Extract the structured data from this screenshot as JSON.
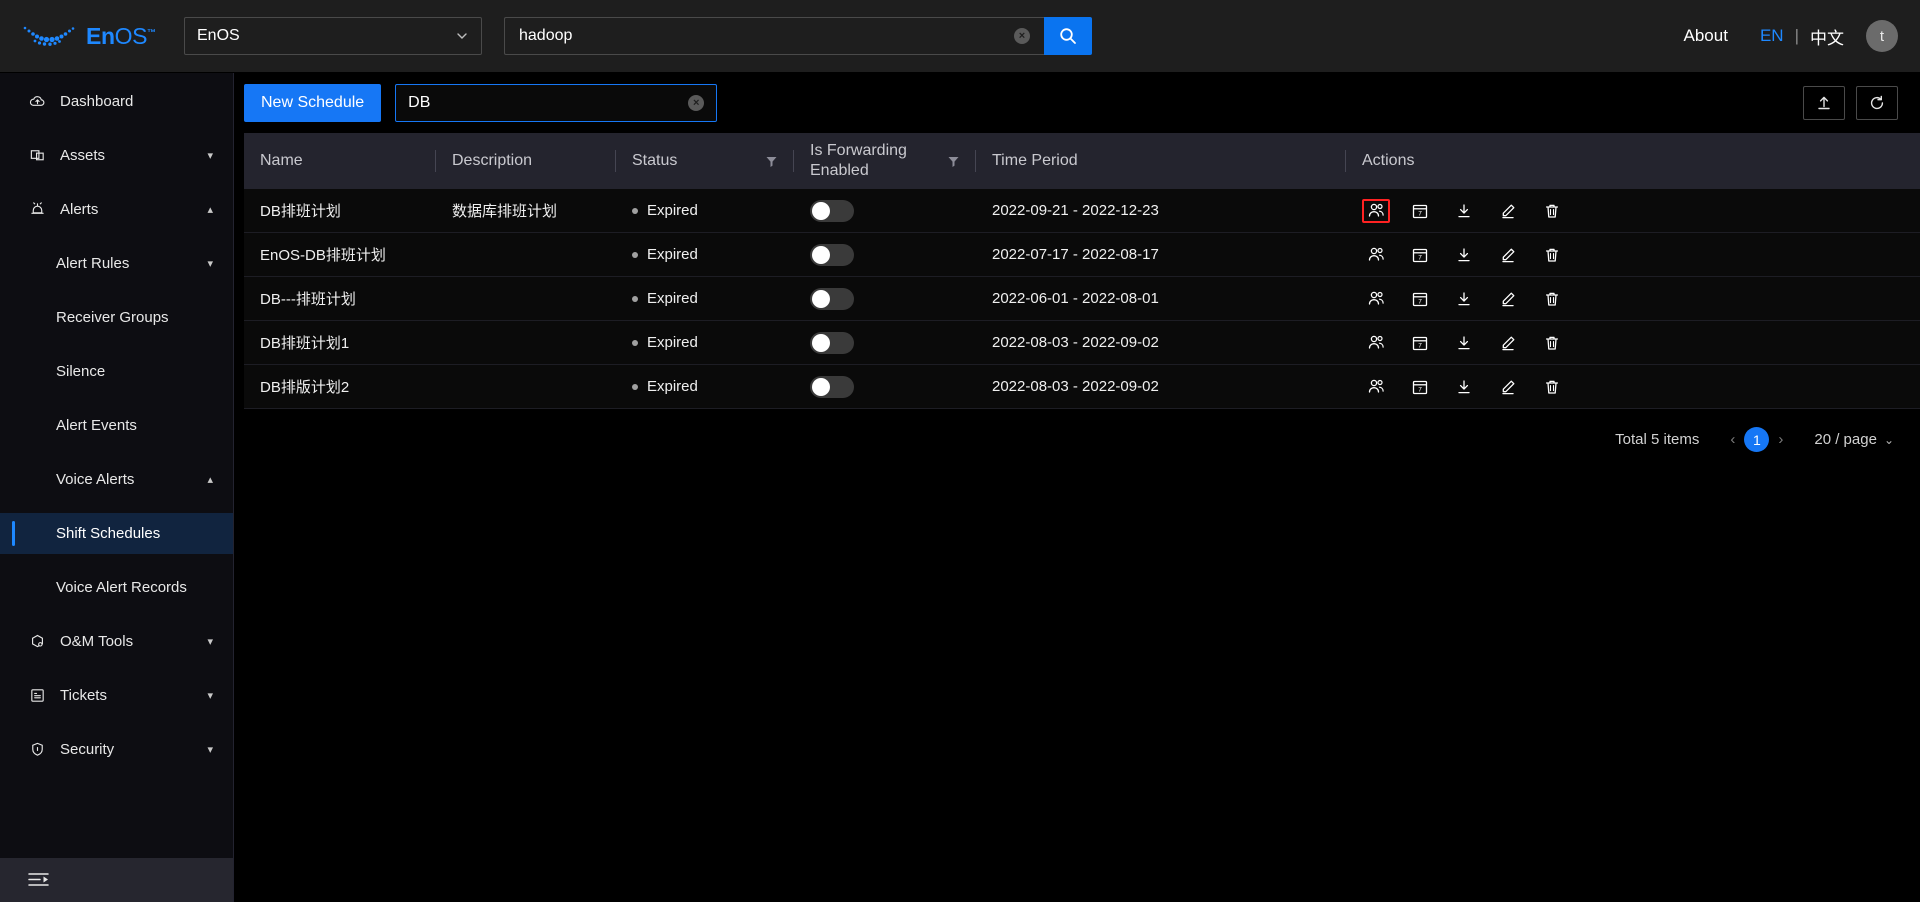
{
  "topbar": {
    "brand": {
      "bold": "En",
      "light": "OS",
      "tm": "™"
    },
    "app_selector": {
      "value": "EnOS",
      "caret": "chevron-down-icon"
    },
    "search": {
      "value": "hadoop",
      "placeholder": "",
      "clear": "×",
      "button_icon": "search-icon"
    },
    "about_label": "About",
    "lang_en": "EN",
    "lang_divider": "|",
    "lang_cn": "中文",
    "avatar_initial": "t"
  },
  "sidebar": {
    "items": [
      {
        "label": "Dashboard",
        "icon": "dashboard-cloud-icon",
        "level": 0,
        "caret": "",
        "active": false
      },
      {
        "label": "Assets",
        "icon": "assets-icon",
        "level": 0,
        "caret": "▾",
        "active": false
      },
      {
        "label": "Alerts",
        "icon": "alerts-bell-icon",
        "level": 0,
        "caret": "▴",
        "active": false
      },
      {
        "label": "Alert Rules",
        "icon": "",
        "level": 1,
        "caret": "▾",
        "active": false
      },
      {
        "label": "Receiver Groups",
        "icon": "",
        "level": 1,
        "caret": "",
        "active": false
      },
      {
        "label": "Silence",
        "icon": "",
        "level": 1,
        "caret": "",
        "active": false
      },
      {
        "label": "Alert Events",
        "icon": "",
        "level": 1,
        "caret": "",
        "active": false
      },
      {
        "label": "Voice Alerts",
        "icon": "",
        "level": 1,
        "caret": "▴",
        "active": false
      },
      {
        "label": "Shift Schedules",
        "icon": "",
        "level": 2,
        "caret": "",
        "active": true
      },
      {
        "label": "Voice Alert Records",
        "icon": "",
        "level": 2,
        "caret": "",
        "active": false
      },
      {
        "label": "O&M Tools",
        "icon": "om-tools-icon",
        "level": 0,
        "caret": "▾",
        "active": false
      },
      {
        "label": "Tickets",
        "icon": "tickets-icon",
        "level": 0,
        "caret": "▾",
        "active": false
      },
      {
        "label": "Security",
        "icon": "security-shield-icon",
        "level": 0,
        "caret": "▾",
        "active": false
      }
    ],
    "collapse_icon": "menu-fold-icon"
  },
  "toolbar": {
    "new_schedule_label": "New Schedule",
    "filter_value": "DB",
    "filter_clear": "×",
    "upload_icon": "upload-icon",
    "refresh_icon": "refresh-icon"
  },
  "table": {
    "columns": [
      {
        "key": "name",
        "label": "Name",
        "filter": false
      },
      {
        "key": "description",
        "label": "Description",
        "filter": false
      },
      {
        "key": "status",
        "label": "Status",
        "filter": true
      },
      {
        "key": "forwarding",
        "label": "Is Forwarding Enabled",
        "filter": true
      },
      {
        "key": "time_period",
        "label": "Time Period",
        "filter": false
      },
      {
        "key": "actions",
        "label": "Actions",
        "filter": false
      }
    ],
    "rows": [
      {
        "name": "DB排班计划",
        "description": "数据库排班计划",
        "status": "Expired",
        "forwarding_enabled": false,
        "time_period": "2022-09-21 - 2022-12-23",
        "highlight_action": "members-icon"
      },
      {
        "name": "EnOS-DB排班计划",
        "description": "",
        "status": "Expired",
        "forwarding_enabled": false,
        "time_period": "2022-07-17 - 2022-08-17",
        "highlight_action": ""
      },
      {
        "name": "DB---排班计划",
        "description": "",
        "status": "Expired",
        "forwarding_enabled": false,
        "time_period": "2022-06-01 - 2022-08-01",
        "highlight_action": ""
      },
      {
        "name": "DB排班计划1",
        "description": "",
        "status": "Expired",
        "forwarding_enabled": false,
        "time_period": "2022-08-03 - 2022-09-02",
        "highlight_action": ""
      },
      {
        "name": "DB排版计划2",
        "description": "",
        "status": "Expired",
        "forwarding_enabled": false,
        "time_period": "2022-08-03 - 2022-09-02",
        "highlight_action": ""
      }
    ],
    "action_icons": [
      "members-icon",
      "calendar-icon",
      "download-icon",
      "edit-icon",
      "delete-icon"
    ]
  },
  "pagination": {
    "total_label": "Total 5 items",
    "prev": "‹",
    "current_page": "1",
    "next": "›",
    "page_size": "20 / page",
    "page_size_caret": "⌄"
  },
  "colors": {
    "accent": "#1677f5",
    "link": "#1e88ff",
    "highlight_border": "#ff2222",
    "status_dot": "#a0a0a0",
    "header_bg": "#24242e",
    "sidebar_bg": "#0d0d12",
    "active_nav_bg": "#11243f"
  }
}
